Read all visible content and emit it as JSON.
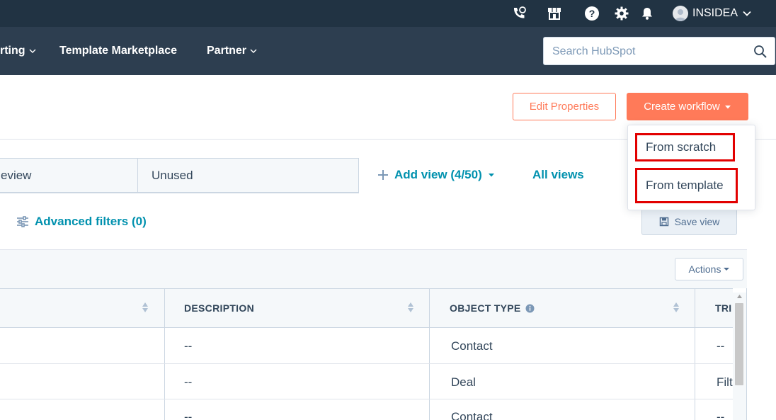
{
  "topbar": {
    "icons": [
      "calling-icon",
      "marketplace-icon",
      "help-icon",
      "settings-icon",
      "notifications-icon"
    ],
    "account_name": "INSIDEA"
  },
  "nav": {
    "items": [
      {
        "label": "rting"
      },
      {
        "label": "Template Marketplace"
      },
      {
        "label": "Partner"
      }
    ],
    "search_placeholder": "Search HubSpot"
  },
  "header": {
    "edit_properties_label": "Edit Properties",
    "create_workflow_label": "Create workflow"
  },
  "create_menu": {
    "items": [
      "From scratch",
      "From template"
    ]
  },
  "views": {
    "tabs": [
      "eview",
      "Unused"
    ],
    "add_view_label": "Add view (4/50)",
    "all_views_label": "All views"
  },
  "filters": {
    "advanced_filters_label": "Advanced filters (0)",
    "save_view_label": "Save view"
  },
  "table": {
    "actions_label": "Actions",
    "columns": [
      "DESCRIPTION",
      "OBJECT TYPE",
      "TRI"
    ],
    "rows": [
      {
        "description": "--",
        "object_type": "Contact",
        "trigger": "--"
      },
      {
        "description": "--",
        "object_type": "Deal",
        "trigger": "Filt"
      },
      {
        "description": "--",
        "object_type": "Contact",
        "trigger": "--"
      }
    ]
  },
  "colors": {
    "topbar": "#213343",
    "navbar": "#2d3e50",
    "accent": "#ff7a59",
    "link": "#0091ae",
    "highlight": "#e20000"
  }
}
